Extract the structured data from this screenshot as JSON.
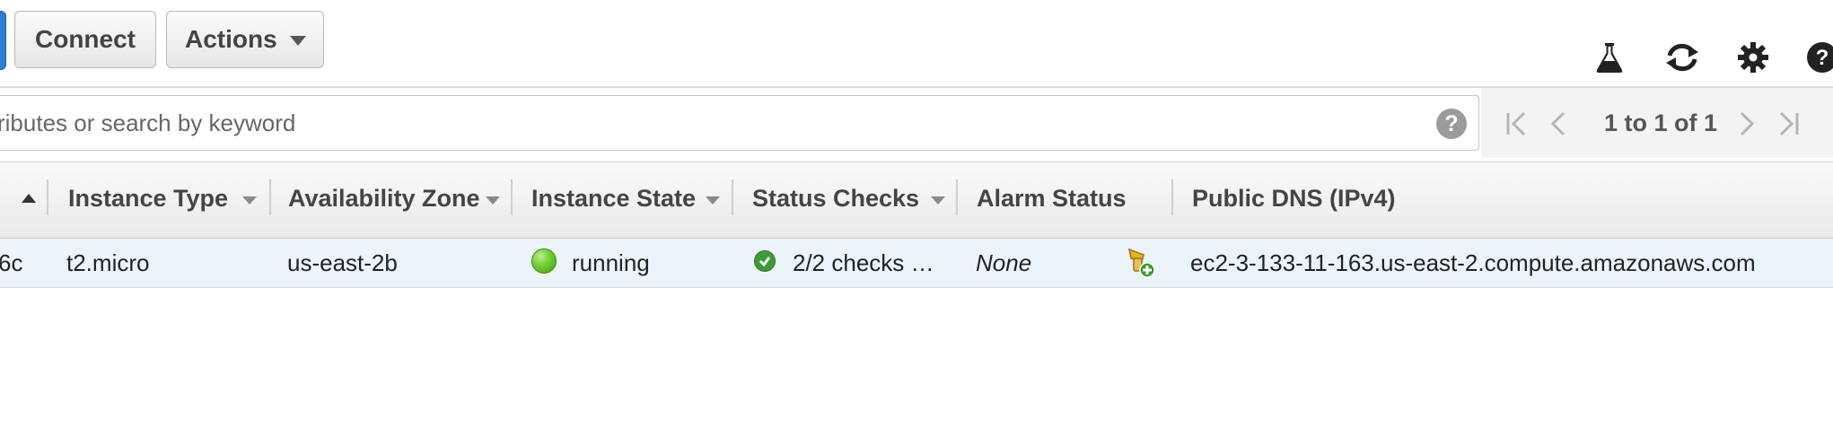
{
  "toolbar": {
    "connect_label": "Connect",
    "actions_label": "Actions",
    "icons": [
      "flask-icon",
      "refresh-icon",
      "gear-icon",
      "help-icon"
    ]
  },
  "filter": {
    "placeholder": "ributes or search by keyword",
    "help_label": "?"
  },
  "pagination": {
    "label": "1 to 1 of 1"
  },
  "table": {
    "columns": [
      {
        "label": "Instance Type"
      },
      {
        "label": "Availability Zone"
      },
      {
        "label": "Instance State"
      },
      {
        "label": "Status Checks"
      },
      {
        "label": "Alarm Status"
      },
      {
        "label": "Public DNS (IPv4)"
      }
    ],
    "rows": [
      {
        "id_fragment": "6c",
        "instance_type": "t2.micro",
        "availability_zone": "us-east-2b",
        "instance_state": "running",
        "status_checks": "2/2 checks …",
        "alarm_status": "None",
        "public_dns": "ec2-3-133-11-163.us-east-2.compute.amazonaws.com"
      }
    ]
  },
  "colors": {
    "running": "#5cc22a",
    "check_ok": "#3e9a38",
    "row_selected": "#ebf3fb"
  }
}
